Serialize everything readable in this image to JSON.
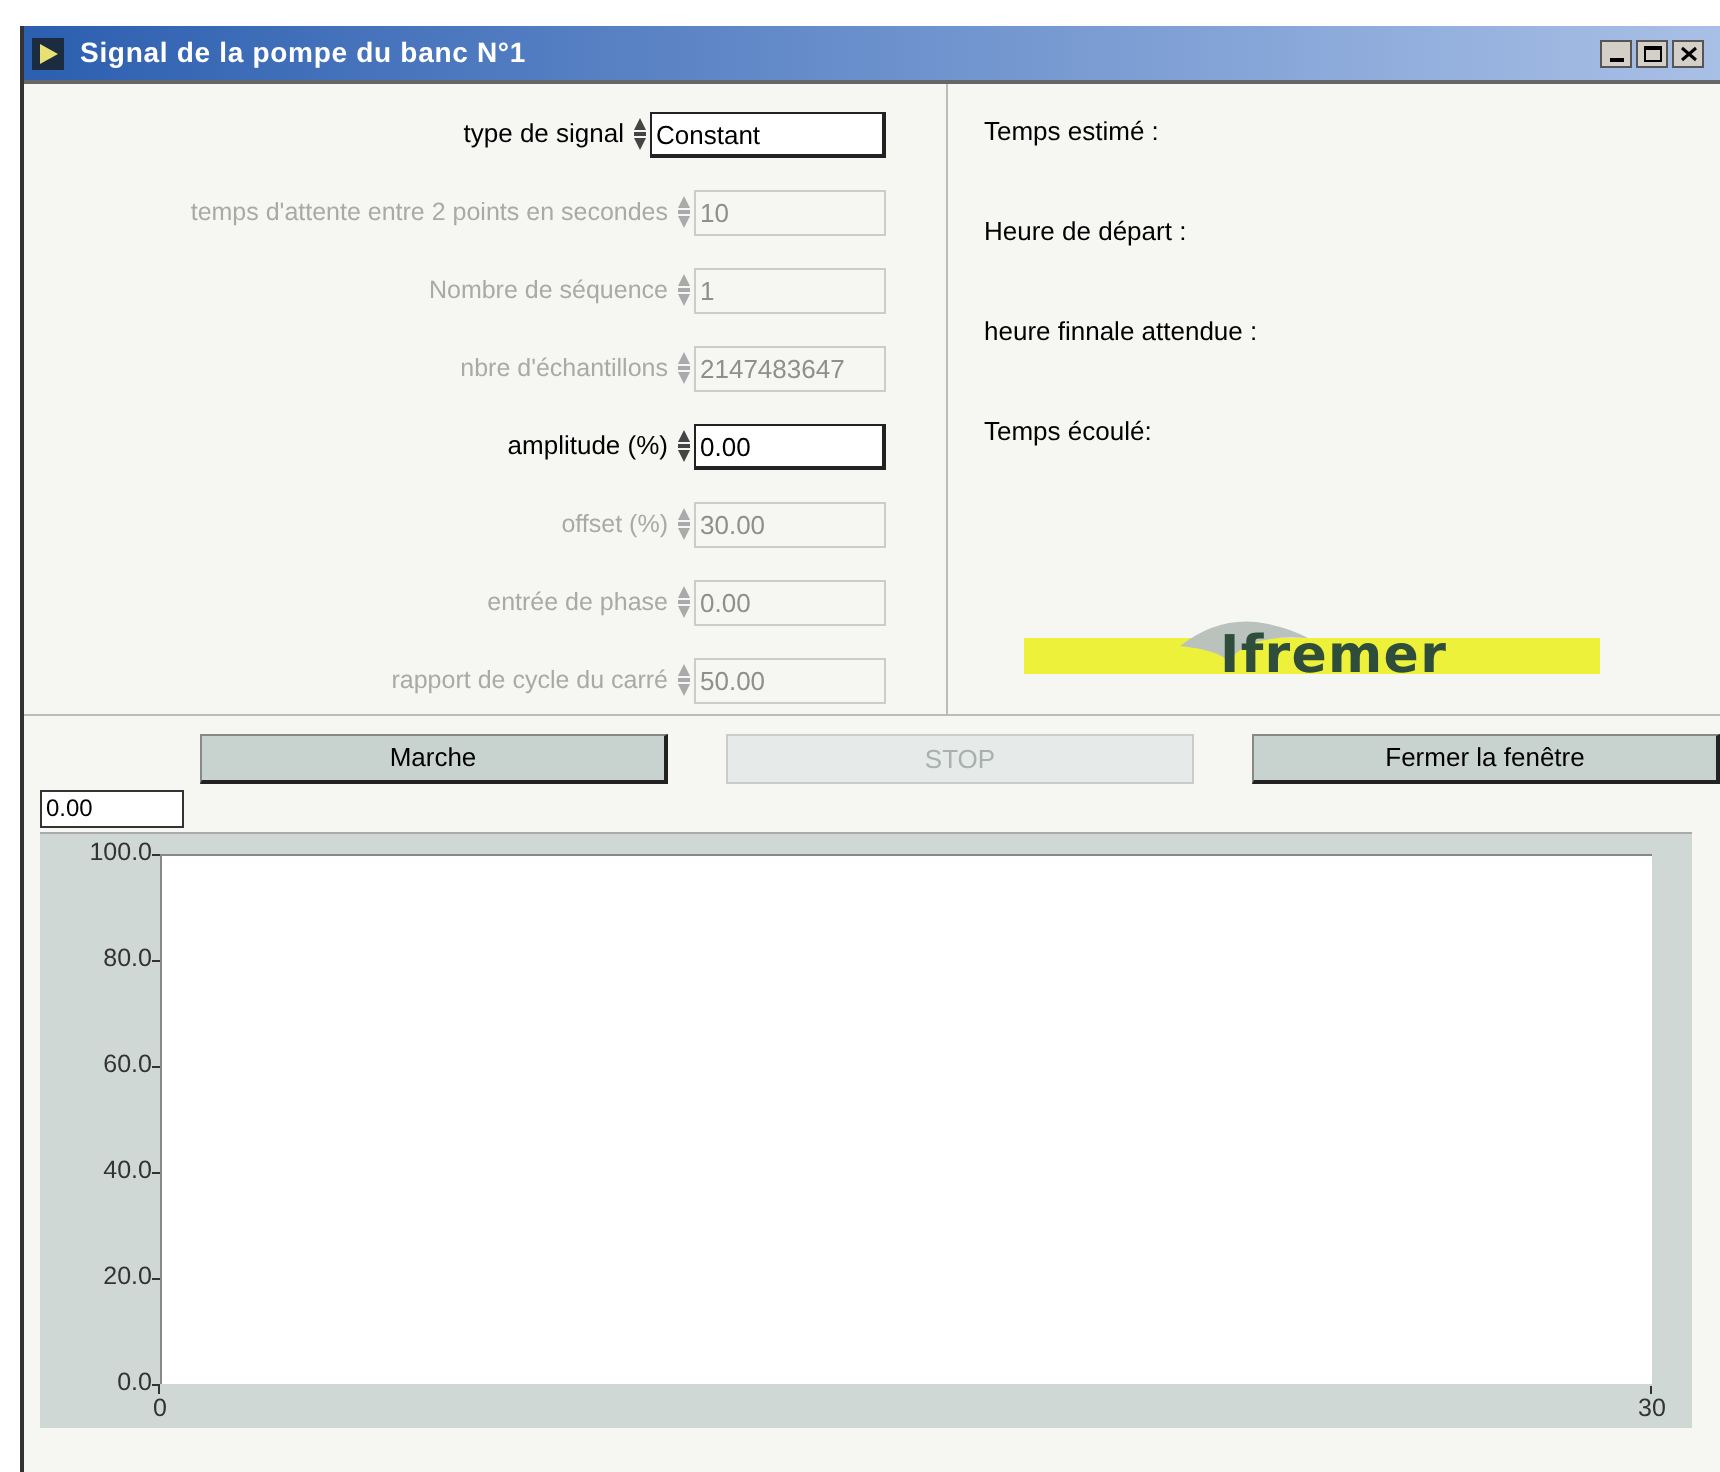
{
  "window": {
    "title": "Signal de la pompe du banc N°1"
  },
  "controls": [
    {
      "label": "type de signal",
      "value": "Constant",
      "disabled": false,
      "kind": "ring"
    },
    {
      "label": "temps d'attente entre 2 points en secondes",
      "value": "10",
      "disabled": true,
      "kind": "numeric"
    },
    {
      "label": "Nombre de séquence",
      "value": "1",
      "disabled": true,
      "kind": "numeric"
    },
    {
      "label": "nbre d'échantillons",
      "value": "2147483647",
      "disabled": true,
      "kind": "numeric"
    },
    {
      "label": "amplitude (%)",
      "value": "0.00",
      "disabled": false,
      "kind": "numeric"
    },
    {
      "label": "offset (%)",
      "value": "30.00",
      "disabled": true,
      "kind": "numeric"
    },
    {
      "label": "entrée de phase",
      "value": "0.00",
      "disabled": true,
      "kind": "numeric"
    },
    {
      "label": "rapport de cycle du carré",
      "value": "50.00",
      "disabled": true,
      "kind": "numeric"
    }
  ],
  "info_labels": [
    "Temps estimé :",
    "Heure de départ :",
    "heure finnale attendue :",
    "Temps écoulé:"
  ],
  "logo": {
    "text": "Ifremer"
  },
  "buttons": [
    {
      "label": "Marche",
      "disabled": false
    },
    {
      "label": "STOP",
      "disabled": true
    },
    {
      "label": "Fermer la fenêtre",
      "disabled": false
    }
  ],
  "display": {
    "value": "0.00"
  },
  "chart": {
    "chart_data": {
      "type": "line",
      "xlim": [
        0,
        30
      ],
      "ylim": [
        0,
        100
      ],
      "xticks": [
        {
          "value": 0,
          "label": "0"
        },
        {
          "value": 30,
          "label": "30"
        }
      ],
      "yticks": [
        {
          "value": 0,
          "label": "0.0"
        },
        {
          "value": 20,
          "label": "20.0"
        },
        {
          "value": 40,
          "label": "40.0"
        },
        {
          "value": 60,
          "label": "60.0"
        },
        {
          "value": 80,
          "label": "80.0"
        },
        {
          "value": 100,
          "label": "100.0"
        }
      ]
    }
  }
}
